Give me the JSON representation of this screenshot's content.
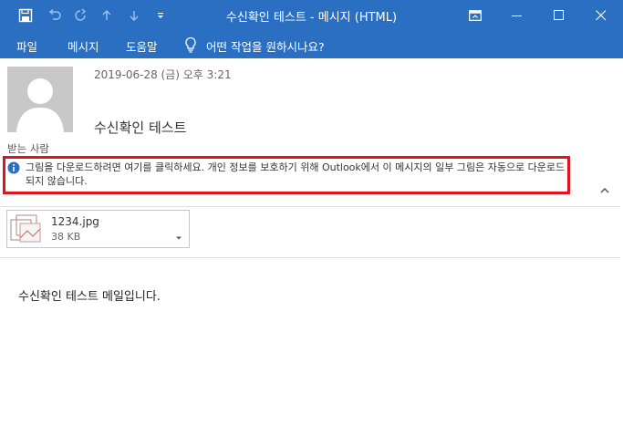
{
  "titlebar": {
    "title": "수신확인 테스트  -  메시지 (HTML)",
    "bg_color": "#2b6fc2",
    "quick_access": [
      "save-icon",
      "undo-icon",
      "redo-icon",
      "up-arrow-icon",
      "down-arrow-icon",
      "customize-qat-icon"
    ],
    "window_controls": [
      "ribbon-display-icon",
      "minimize-icon",
      "maximize-icon",
      "close-icon"
    ]
  },
  "ribbon": {
    "tabs": [
      "파일",
      "메시지",
      "도움말"
    ],
    "tell_me": "어떤 작업을 원하시나요?"
  },
  "message": {
    "date": "2019-06-28 (금) 오후 3:21",
    "subject": "수신확인 테스트",
    "to_label": "받는 사람",
    "info_text": "그림을 다운로드하려면 여기를 클릭하세요. 개인 정보를 보호하기 위해 Outlook에서 이 메시지의 일부 그림은 자동으로 다운로드되지 않습니다.",
    "highlight_color": "#e0141e",
    "body": "수신확인 테스트 메일입니다."
  },
  "attachment": {
    "name": "1234.jpg",
    "size": "38 KB"
  }
}
